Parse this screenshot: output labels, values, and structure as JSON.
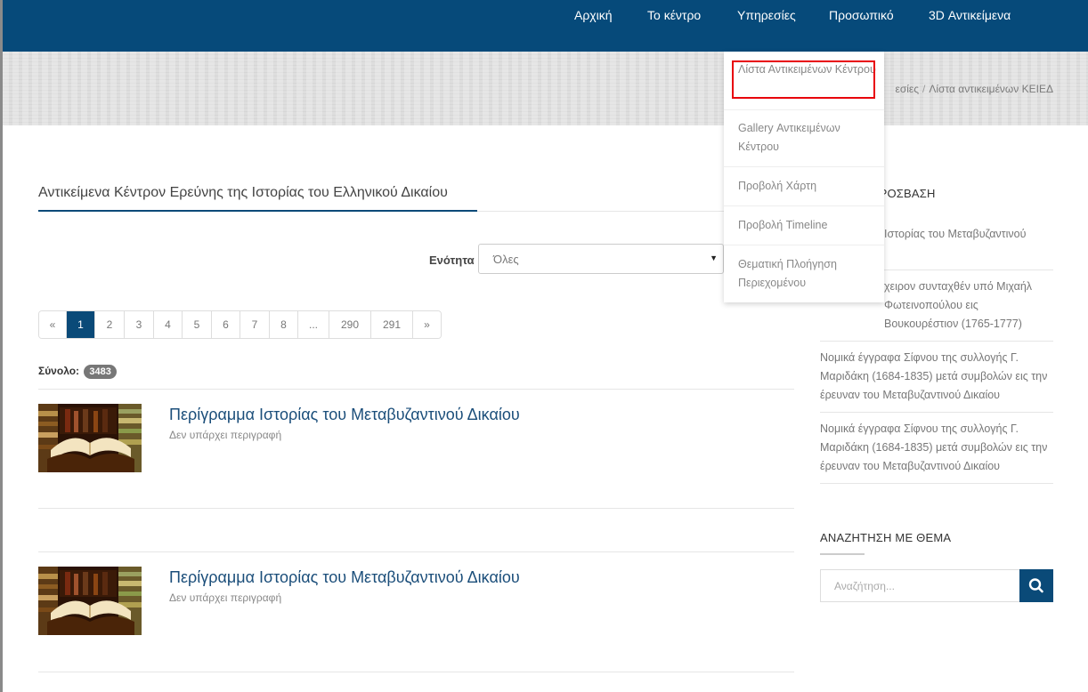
{
  "nav": {
    "items": [
      "Αρχική",
      "Το κέντρο",
      "Υπηρεσίες",
      "Προσωπικό",
      "3D Αντικείμενα"
    ]
  },
  "breadcrumb": {
    "visible_prefix": "εσίες",
    "separator": "/",
    "current": "Λίστα αντικειμένων ΚΕΙΕΔ"
  },
  "dropdown": {
    "items": [
      "Λίστα Αντικειμένων Κέντρου",
      "Gallery Αντικειμένων Κέντρου",
      "Προβολή Χάρτη",
      "Προβολή Timeline",
      "Θεματική Πλοήγηση Περιεχομένου"
    ]
  },
  "main": {
    "heading": "Αντικείμενα Κέντρον Ερεύνης της Ιστορίας του Ελληνικού Δικαίου",
    "filter_label": "Ενότητα",
    "filter_value": "Όλες",
    "pagination": [
      "«",
      "1",
      "2",
      "3",
      "4",
      "5",
      "6",
      "7",
      "8",
      "...",
      "290",
      "291",
      "»"
    ],
    "active_page": "1",
    "total_label": "Σύνολο:",
    "total_count": "3483",
    "items": [
      {
        "title": "Περίγραμμα Ιστορίας του Μεταβυζαντινού Δικαίου",
        "description": "Δεν υπάρχει περιγραφή"
      },
      {
        "title": "Περίγραμμα Ιστορίας του Μεταβυζαντινού Δικαίου",
        "description": "Δεν υπάρχει περιγραφή"
      }
    ]
  },
  "sidebar": {
    "recent_heading_visible": "ΠΡΟΣΒΑΣΗ",
    "recent_links": [
      "Ιστορίας του Μεταβυζαντινού",
      "χειρον συνταχθέν υπό Μιχαήλ Φωτεινοπούλου εις Βουκουρέστιον (1765-1777)",
      "Νομικά έγγραφα Σίφνου της συλλογής Γ. Μαριδάκη (1684-1835) μετά συμβολών εις την έρευναν του Μεταβυζαντινού Δικαίου",
      "Νομικά έγγραφα Σίφνου της συλλογής Γ. Μαριδάκη (1684-1835) μετά συμβολών εις την έρευναν του Μεταβυζαντινού Δικαίου"
    ],
    "search_heading": "ΑΝΑΖΗΤΗΣΗ ΜΕ ΘΕΜΑ",
    "search_placeholder": "Αναζήτηση...",
    "search_icon": "search-icon"
  },
  "colors": {
    "brand_blue": "#064a7a",
    "highlight_red": "#e8000b"
  }
}
